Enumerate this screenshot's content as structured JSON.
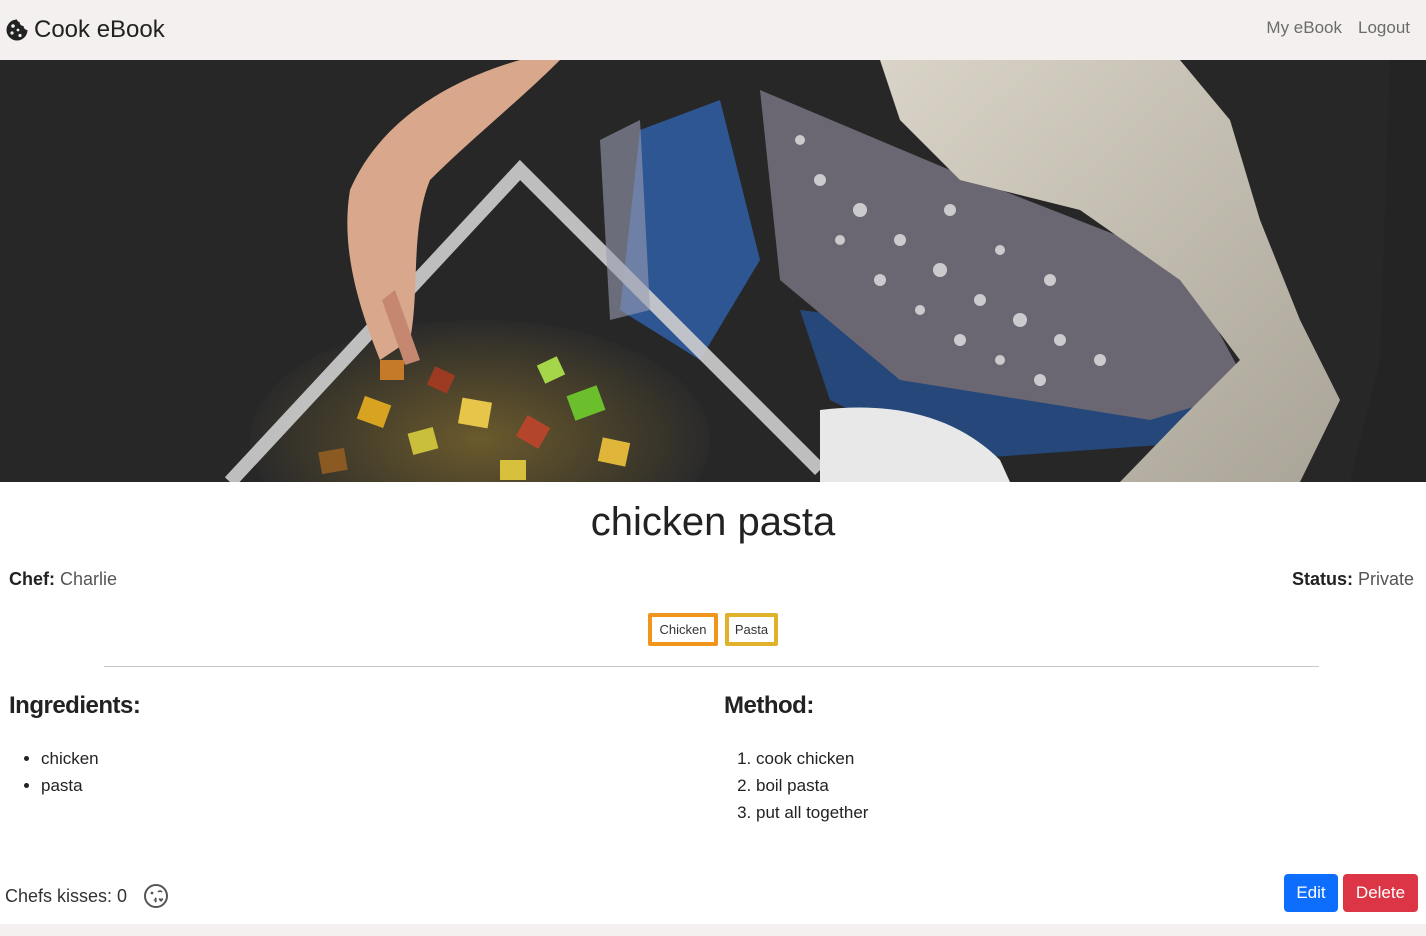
{
  "navbar": {
    "brand": "Cook eBook",
    "brand_icon": "cookie-icon",
    "links": [
      "My eBook",
      "Logout"
    ]
  },
  "hero": {
    "image": "hero-cooking-photo"
  },
  "recipe": {
    "title": "chicken pasta",
    "chef_label": "Chef:",
    "chef": "Charlie",
    "status_label": "Status:",
    "status": "Private",
    "tags": [
      "Chicken",
      "Pasta"
    ],
    "ingredients_title": "Ingredients:",
    "ingredients": [
      "chicken",
      "pasta"
    ],
    "method_title": "Method:",
    "method": [
      "cook chicken",
      "boil pasta",
      "put all together"
    ]
  },
  "footer": {
    "kisses_label": "Chefs kisses: 0",
    "kiss_icon": "kiss-face-icon",
    "edit_label": "Edit",
    "delete_label": "Delete"
  },
  "colors": {
    "navbar_bg": "#f3f0ef",
    "tag_chicken_border": "#f0961d",
    "tag_pasta_border": "#e0b12a",
    "edit_bg": "#0d6efd",
    "delete_bg": "#dc3545"
  }
}
